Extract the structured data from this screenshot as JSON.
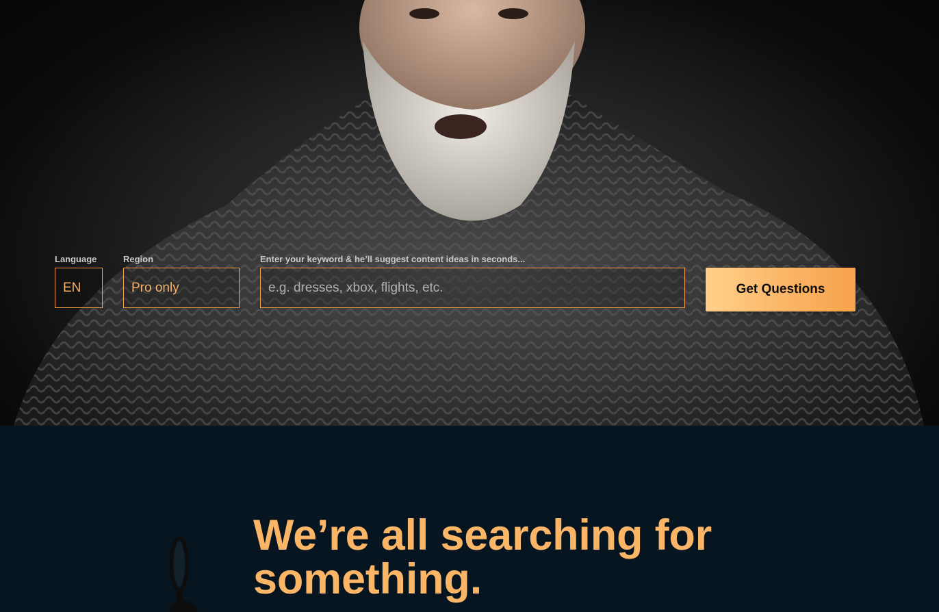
{
  "hero": {
    "image": "bearded-man-in-knit-sweater"
  },
  "search_form": {
    "language": {
      "label": "Language",
      "value": "EN"
    },
    "region": {
      "label": "Region",
      "value": "Pro only"
    },
    "keyword": {
      "label": "Enter your keyword & he’ll suggest content ideas in seconds...",
      "placeholder": "e.g. dresses, xbox, flights, etc.",
      "value": ""
    },
    "submit_label": "Get Questions"
  },
  "intro": {
    "headline": "We’re all searching for something.",
    "icon": "magnifying-glass-icon"
  },
  "colors": {
    "accent": "#fbb567",
    "accent_border": "#f5a24b",
    "dark_background": "#061520"
  }
}
